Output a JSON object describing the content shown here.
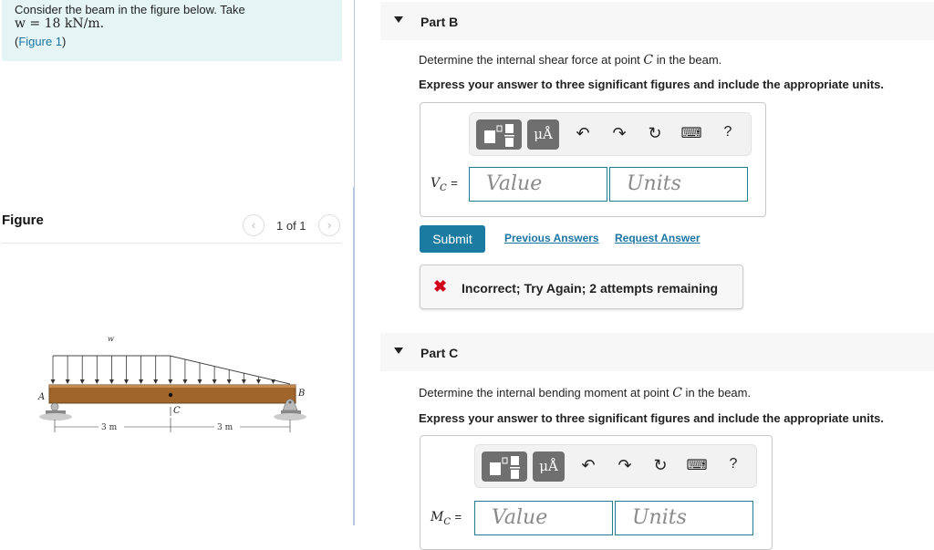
{
  "prompt": {
    "line1": "Consider the beam in the figure below. Take",
    "line2_math": "w = 18 kN/m.",
    "figure_link_open": "(",
    "figure_link": "Figure 1",
    "figure_link_close": ")"
  },
  "figure_panel": {
    "title": "Figure",
    "pager_text": "1 of 1",
    "prev_icon": "‹",
    "next_icon": "›",
    "diagram": {
      "load_label": "w",
      "support_a": "A",
      "support_b": "B",
      "point_c": "C",
      "dim_left": "3 m",
      "dim_right": "3 m"
    }
  },
  "parts": [
    {
      "title": "Part B",
      "question_pre": "Determine the internal shear force at point ",
      "question_var": "C",
      "question_post": " in the beam.",
      "instruction": "Express your answer to three significant figures and include the appropriate units.",
      "variable": "V",
      "variable_sub": "C",
      "equals": "=",
      "value_placeholder": "Value",
      "units_placeholder": "Units",
      "toolbar": {
        "units_btn": "μÅ",
        "undo": "↶",
        "redo": "↷",
        "reset": "↻",
        "keyboard": "⌨",
        "help": "?"
      },
      "submit_label": "Submit",
      "previous_answers": "Previous Answers",
      "request_answer": "Request Answer",
      "feedback_icon": "✖",
      "feedback": "Incorrect; Try Again; 2 attempts remaining"
    },
    {
      "title": "Part C",
      "question_pre": "Determine the internal bending moment at point ",
      "question_var": "C",
      "question_post": " in the beam.",
      "instruction": "Express your answer to three significant figures and include the appropriate units.",
      "variable": "M",
      "variable_sub": "C",
      "equals": "=",
      "value_placeholder": "Value",
      "units_placeholder": "Units",
      "toolbar": {
        "units_btn": "μÅ",
        "undo": "↶",
        "redo": "↷",
        "reset": "↻",
        "keyboard": "⌨",
        "help": "?"
      }
    }
  ],
  "colors": {
    "prompt_bg": "#e5f5f6",
    "link": "#1b75a3",
    "submit_bg": "#1b7ba0",
    "field_border": "#1e7b91",
    "error": "#d0021b",
    "beam": "#a0652a"
  }
}
